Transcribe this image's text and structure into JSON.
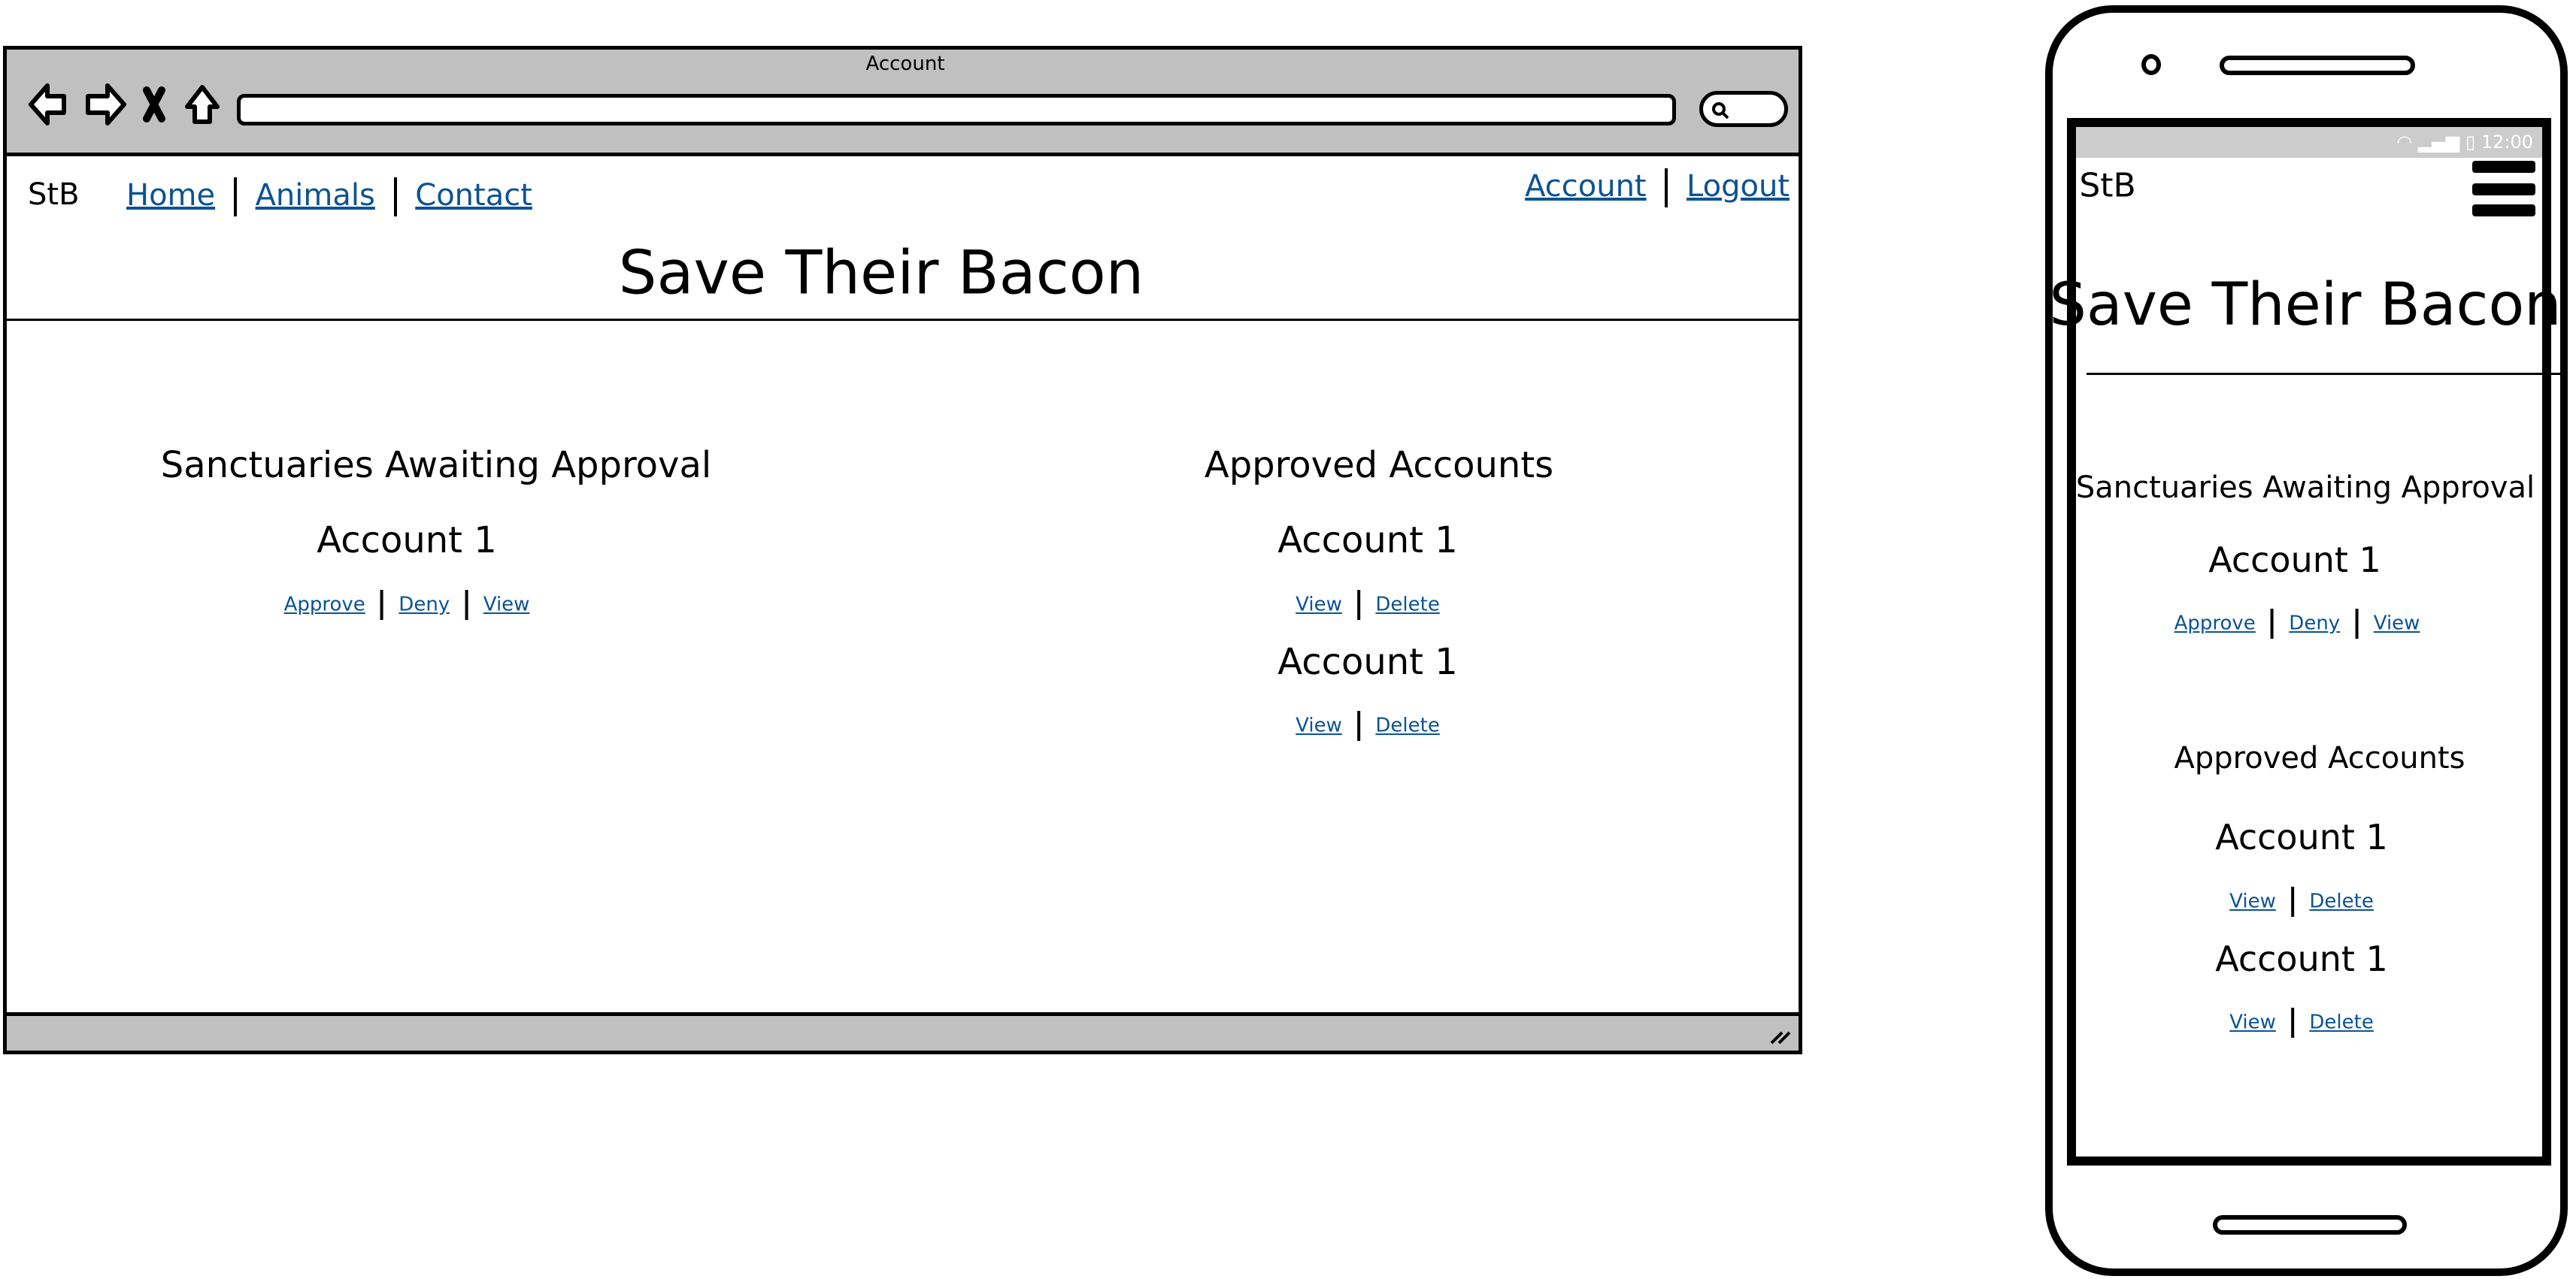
{
  "browser": {
    "window_title": "Account",
    "address_value": "",
    "search_icon": "search-icon"
  },
  "nav": {
    "brand": "StB",
    "links": [
      "Home",
      "Animals",
      "Contact"
    ],
    "right_links": [
      "Account",
      "Logout"
    ]
  },
  "site_title": "Save Their Bacon",
  "pending": {
    "heading": "Sanctuaries Awaiting Approval",
    "items": [
      {
        "name": "Account 1",
        "actions": [
          "Approve",
          "Deny",
          "View"
        ]
      }
    ]
  },
  "approved": {
    "heading": "Approved Accounts",
    "items": [
      {
        "name": "Account 1",
        "actions": [
          "View",
          "Delete"
        ]
      },
      {
        "name": "Account 1",
        "actions": [
          "View",
          "Delete"
        ]
      }
    ]
  },
  "mobile": {
    "status_time": "12:00",
    "brand": "StB",
    "menu_icon": "hamburger-icon"
  },
  "colors": {
    "link": "#0b5394",
    "chrome": "#c0c0c0"
  }
}
